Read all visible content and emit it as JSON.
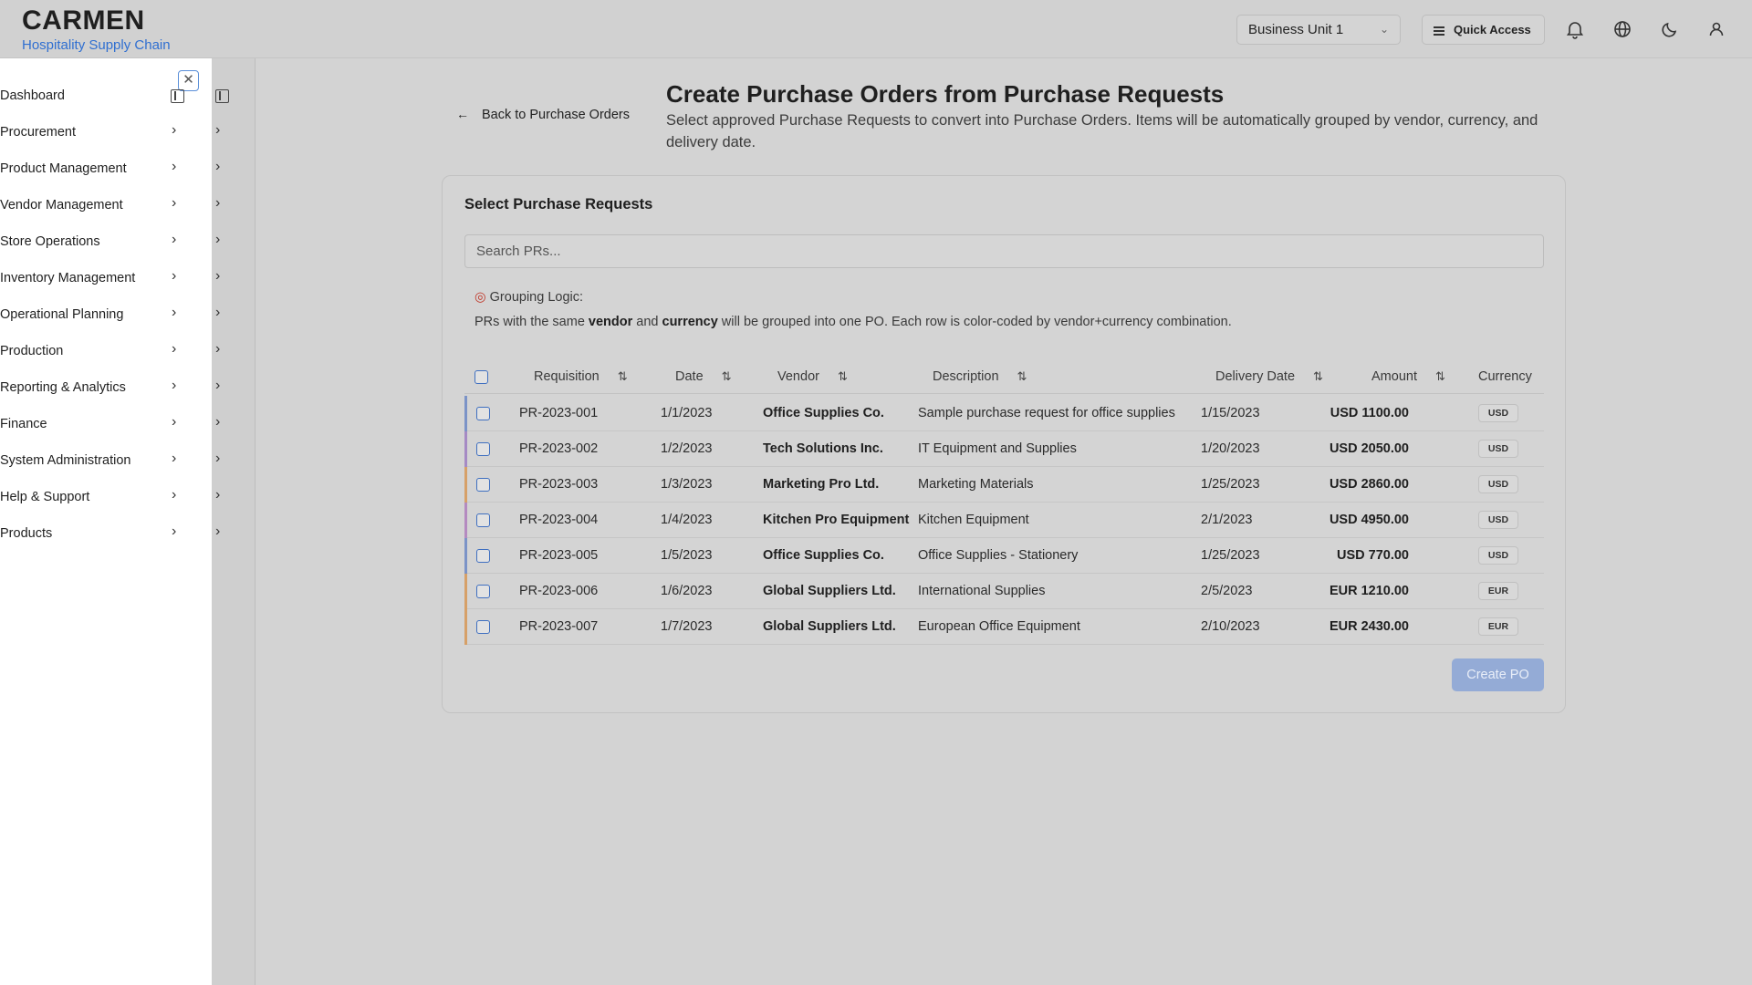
{
  "app": {
    "name": "CARMEN",
    "subtitle": "Hospitality Supply Chain"
  },
  "header": {
    "business_unit": "Business Unit 1",
    "quick_access": "Quick Access",
    "icons": [
      "bell-icon",
      "globe-icon",
      "moon-icon",
      "user-icon"
    ]
  },
  "sidebar": {
    "items": [
      {
        "label": "Dashboard"
      },
      {
        "label": "Procurement"
      },
      {
        "label": "Product Management"
      },
      {
        "label": "Vendor Management"
      },
      {
        "label": "Store Operations"
      },
      {
        "label": "Inventory Management"
      },
      {
        "label": "Operational Planning"
      },
      {
        "label": "Production"
      },
      {
        "label": "Reporting & Analytics"
      },
      {
        "label": "Finance"
      },
      {
        "label": "System Administration"
      },
      {
        "label": "Help & Support"
      },
      {
        "label": "Products"
      }
    ]
  },
  "page": {
    "back_label": "Back to Purchase Orders",
    "title": "Create Purchase Orders from Purchase Requests",
    "description": "Select approved Purchase Requests to convert into Purchase Orders. Items will be automatically grouped by vendor, currency, and delivery date."
  },
  "card": {
    "title": "Select Purchase Requests",
    "search_placeholder": "Search PRs...",
    "grouping_title": "Grouping Logic:",
    "grouping_text_1": "PRs with the same ",
    "grouping_bold_1": "vendor",
    "grouping_text_2": " and ",
    "grouping_bold_2": "currency",
    "grouping_text_3": " will be grouped into one PO. Each row is color-coded by vendor+currency combination.",
    "create_label": "Create PO"
  },
  "table": {
    "headers": {
      "requisition": "Requisition",
      "date": "Date",
      "vendor": "Vendor",
      "description": "Description",
      "delivery": "Delivery Date",
      "amount": "Amount",
      "currency": "Currency"
    },
    "rows": [
      {
        "req": "PR-2023-001",
        "date": "1/1/2023",
        "vendor": "Office Supplies Co.",
        "desc": "Sample purchase request for office supplies",
        "delivery": "1/15/2023",
        "amount": "USD 1100.00",
        "currency": "USD",
        "color": "#7b93c7"
      },
      {
        "req": "PR-2023-002",
        "date": "1/2/2023",
        "vendor": "Tech Solutions Inc.",
        "desc": "IT Equipment and Supplies",
        "delivery": "1/20/2023",
        "amount": "USD 2050.00",
        "currency": "USD",
        "color": "#a58ac4"
      },
      {
        "req": "PR-2023-003",
        "date": "1/3/2023",
        "vendor": "Marketing Pro Ltd.",
        "desc": "Marketing Materials",
        "delivery": "1/25/2023",
        "amount": "USD 2860.00",
        "currency": "USD",
        "color": "#d6a068"
      },
      {
        "req": "PR-2023-004",
        "date": "1/4/2023",
        "vendor": "Kitchen Pro Equipment",
        "desc": "Kitchen Equipment",
        "delivery": "2/1/2023",
        "amount": "USD 4950.00",
        "currency": "USD",
        "color": "#b48ac0"
      },
      {
        "req": "PR-2023-005",
        "date": "1/5/2023",
        "vendor": "Office Supplies Co.",
        "desc": "Office Supplies - Stationery",
        "delivery": "1/25/2023",
        "amount": "USD 770.00",
        "currency": "USD",
        "color": "#7b93c7"
      },
      {
        "req": "PR-2023-006",
        "date": "1/6/2023",
        "vendor": "Global Suppliers Ltd.",
        "desc": "International Supplies",
        "delivery": "2/5/2023",
        "amount": "EUR 1210.00",
        "currency": "EUR",
        "color": "#d6a068"
      },
      {
        "req": "PR-2023-007",
        "date": "1/7/2023",
        "vendor": "Global Suppliers Ltd.",
        "desc": "European Office Equipment",
        "delivery": "2/10/2023",
        "amount": "EUR 2430.00",
        "currency": "EUR",
        "color": "#d6a068"
      }
    ]
  }
}
